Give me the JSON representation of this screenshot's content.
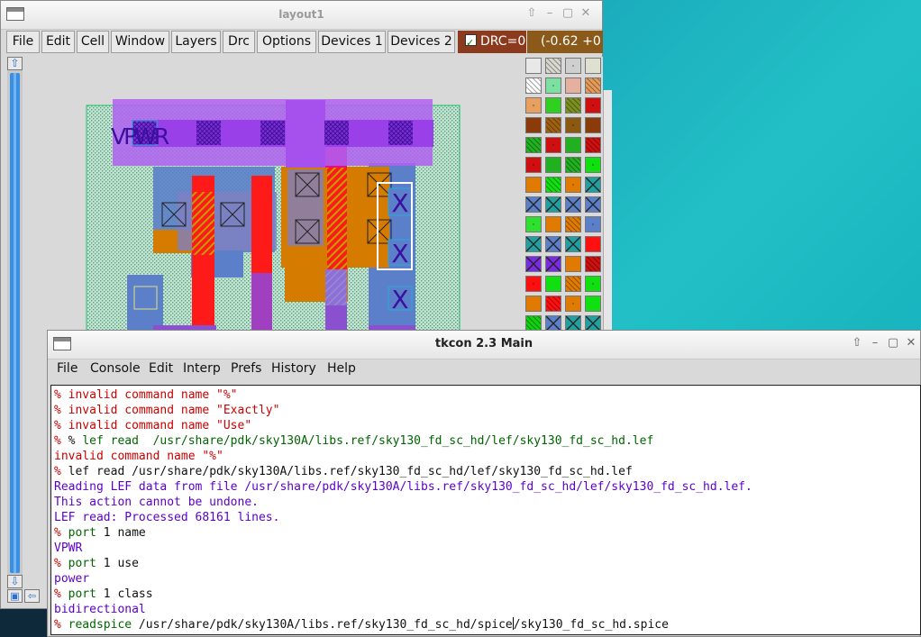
{
  "layout_window": {
    "title": "layout1",
    "menu": [
      "File",
      "Edit",
      "Cell",
      "Window",
      "Layers",
      "Drc",
      "Options",
      "Devices 1",
      "Devices 2"
    ],
    "drc_label": "DRC=0",
    "coord_readout": "(-0.62 +0",
    "canvas_label": "VPWR",
    "scroll_up": "⇧",
    "scroll_down": "⇩"
  },
  "tkcon_window": {
    "title": "tkcon 2.3 Main",
    "menu": [
      "File",
      "Console",
      "Edit",
      "Interp",
      "Prefs",
      "History",
      "Help"
    ],
    "lines": [
      {
        "kind": "err",
        "prompt": "% ",
        "text": "invalid command name \"%\""
      },
      {
        "kind": "err",
        "prompt": "% ",
        "text": "invalid command name \"Exactly\""
      },
      {
        "kind": "err",
        "prompt": "% ",
        "text": "invalid command name \"Use\""
      },
      {
        "kind": "cmd2",
        "prompt": "% ",
        "text": "% lef read  /usr/share/pdk/sky130A/libs.ref/sky130_fd_sc_hd/lef/sky130_fd_sc_hd.lef"
      },
      {
        "kind": "errplain",
        "prompt": "",
        "text": "invalid command name \"%\""
      },
      {
        "kind": "plaincmd",
        "prompt": "% ",
        "text": "lef read /usr/share/pdk/sky130A/libs.ref/sky130_fd_sc_hd/lef/sky130_fd_sc_hd.lef"
      },
      {
        "kind": "out",
        "prompt": "",
        "text": "Reading LEF data from file /usr/share/pdk/sky130A/libs.ref/sky130_fd_sc_hd/lef/sky130_fd_sc_hd.lef."
      },
      {
        "kind": "out",
        "prompt": "",
        "text": "This action cannot be undone."
      },
      {
        "kind": "out",
        "prompt": "",
        "text": "LEF read: Processed 68161 lines."
      },
      {
        "kind": "cmd",
        "prompt": "% ",
        "text": "port 1 name"
      },
      {
        "kind": "out",
        "prompt": "",
        "text": "VPWR"
      },
      {
        "kind": "cmd",
        "prompt": "% ",
        "text": "port 1 use"
      },
      {
        "kind": "out",
        "prompt": "",
        "text": "power"
      },
      {
        "kind": "cmd",
        "prompt": "% ",
        "text": "port 1 class"
      },
      {
        "kind": "out",
        "prompt": "",
        "text": "bidirectional"
      },
      {
        "kind": "input",
        "prompt": "% ",
        "text_before": "readspice /usr/share/pdk/sky130A/libs.ref/sky130_fd_sc_hd/spice",
        "text_after": "/sky130_fd_sc_hd.spice"
      }
    ]
  },
  "colors": {
    "nwell": "#17c26b",
    "poly": "#ff1a1a",
    "metal1": "#b060f0",
    "diff": "#5b7fc8",
    "li": "#8a6ad6",
    "pdiff": "#d47b00",
    "drc_bg": "#8b3a1e",
    "error_text": "#cc0000",
    "command_text": "#006400",
    "output_text": "#5a00c8"
  }
}
